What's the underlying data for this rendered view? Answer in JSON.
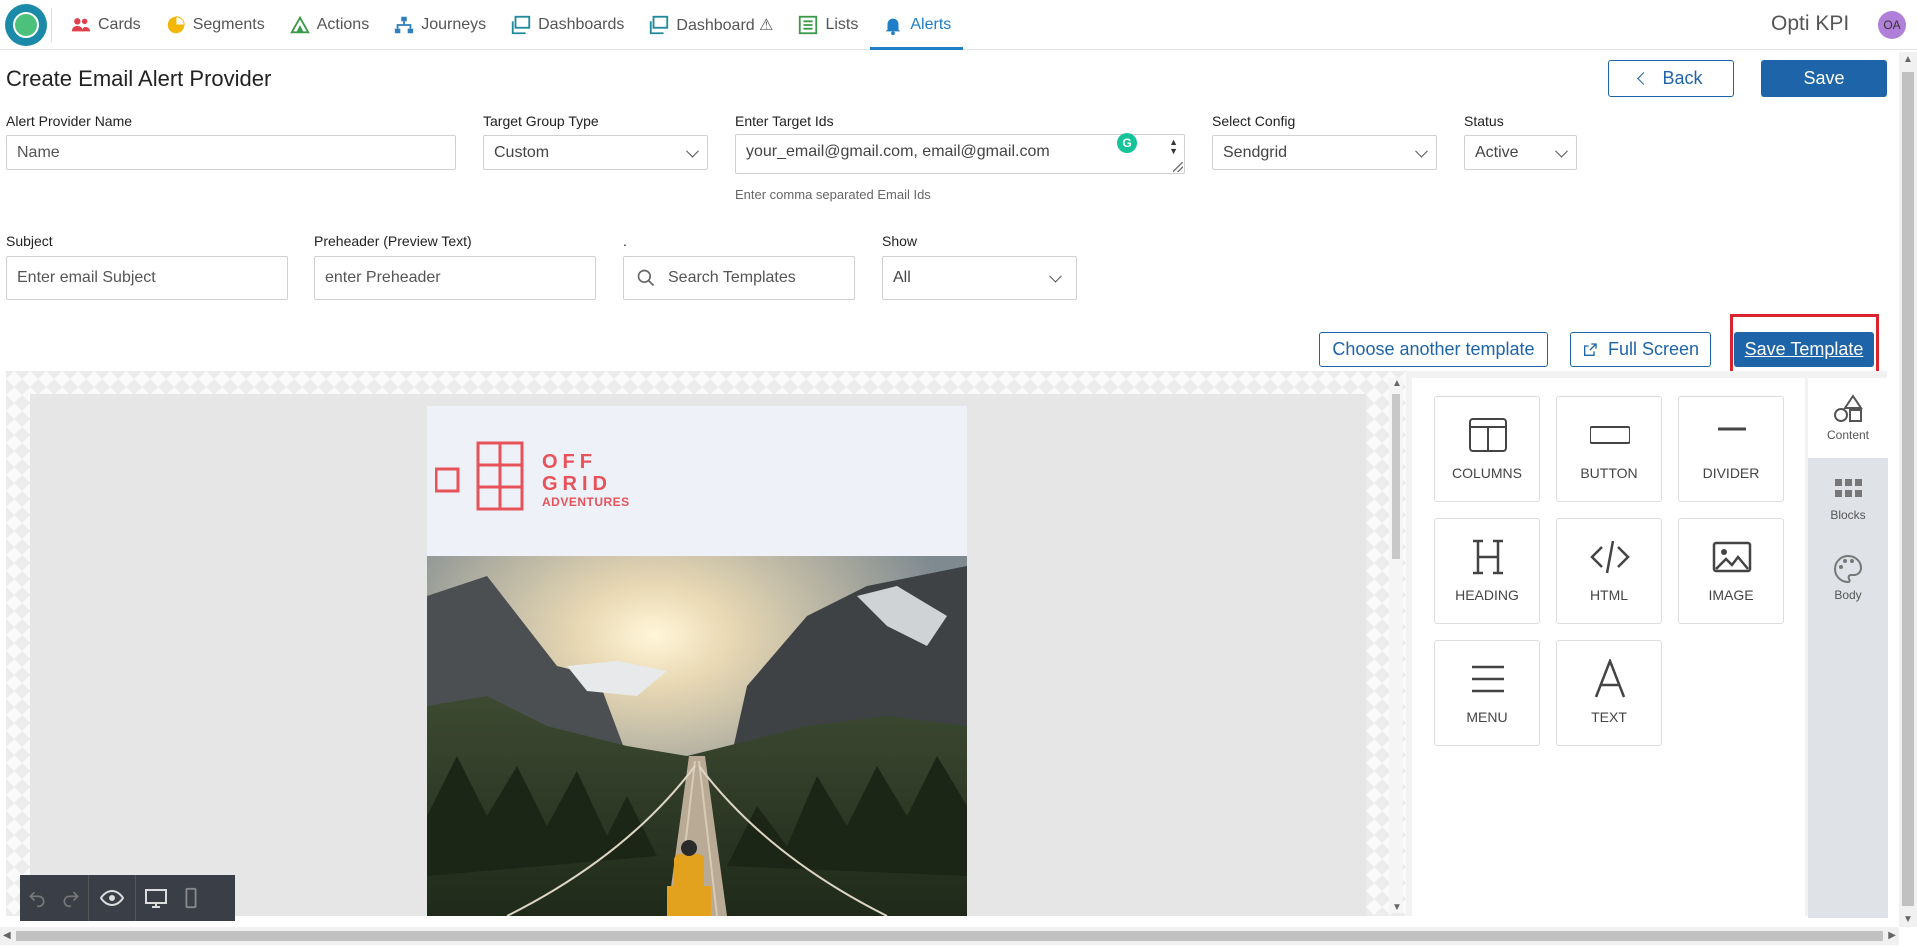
{
  "nav": {
    "items": [
      {
        "label": "Cards",
        "icon": "users-icon"
      },
      {
        "label": "Segments",
        "icon": "pie-chart-icon"
      },
      {
        "label": "Actions",
        "icon": "actions-icon"
      },
      {
        "label": "Journeys",
        "icon": "journeys-icon"
      },
      {
        "label": "Dashboards",
        "icon": "dashboards-icon"
      },
      {
        "label": "Dashboard ⚠",
        "icon": "dashboard-icon"
      },
      {
        "label": "Lists",
        "icon": "list-icon"
      },
      {
        "label": "Alerts",
        "icon": "bell-icon"
      }
    ],
    "active": "Alerts",
    "brand": "Opti KPI",
    "avatar": "OA",
    "accent": "#1e7ec8"
  },
  "page": {
    "title": "Create Email Alert Provider",
    "back_label": "Back",
    "save_label": "Save"
  },
  "form": {
    "provider_name": {
      "label": "Alert Provider Name",
      "placeholder": "Name"
    },
    "target_group_type": {
      "label": "Target Group Type",
      "value": "Custom"
    },
    "target_ids": {
      "label": "Enter Target Ids",
      "value": "your_email@gmail.com, email@gmail.com",
      "hint": "Enter comma separated Email Ids"
    },
    "config": {
      "label": "Select Config",
      "value": "Sendgrid"
    },
    "status": {
      "label": "Status",
      "value": "Active"
    },
    "subject": {
      "label": "Subject",
      "placeholder": "Enter email Subject"
    },
    "preheader": {
      "label": "Preheader (Preview Text)",
      "placeholder": "enter Preheader"
    },
    "search_templates": {
      "label": ".",
      "placeholder": "Search Templates"
    },
    "show": {
      "label": "Show",
      "value": "All"
    }
  },
  "editor_actions": {
    "choose_template": "Choose another template",
    "full_screen": "Full Screen",
    "save_template": "Save Template"
  },
  "email_preview": {
    "logo_line1": "OFF",
    "logo_line2": "GRID",
    "logo_line3": "ADVENTURES",
    "logo_color": "#e8525a"
  },
  "content_tools": [
    "COLUMNS",
    "BUTTON",
    "DIVIDER",
    "HEADING",
    "HTML",
    "IMAGE",
    "MENU",
    "TEXT"
  ],
  "side_tabs": [
    "Content",
    "Blocks",
    "Body"
  ],
  "colors": {
    "primary": "#1e64a8",
    "highlight": "#d9232e"
  }
}
